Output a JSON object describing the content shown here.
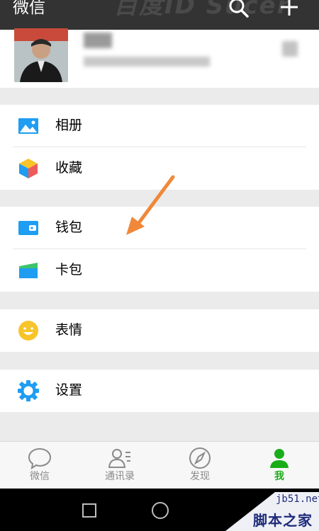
{
  "header": {
    "title": "微信",
    "watermark": "百度ID Sucer"
  },
  "menu": {
    "album": "相册",
    "favorites": "收藏",
    "wallet": "钱包",
    "card_wallet": "卡包",
    "stickers": "表情",
    "settings": "设置"
  },
  "tabs": [
    {
      "label": "微信",
      "icon": "chat-icon"
    },
    {
      "label": "通讯录",
      "icon": "contacts-icon"
    },
    {
      "label": "发现",
      "icon": "compass-icon"
    },
    {
      "label": "我",
      "icon": "person-icon",
      "active": true
    }
  ],
  "site": {
    "url": "jb51.net",
    "name": "脚本之家"
  },
  "colors": {
    "header": "#333333",
    "accent": "#1aad19",
    "arrow": "#f0883a",
    "icon_blue": "#1e9df2",
    "sticker": "#f7c42a"
  }
}
